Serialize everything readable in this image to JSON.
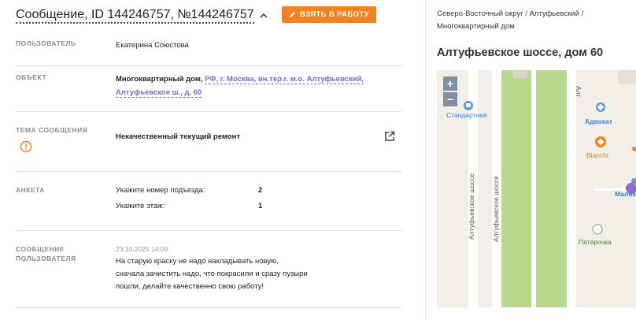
{
  "header": {
    "title": "Сообщение, ID 144246757, №144246757",
    "take_button": "ВЗЯТЬ В РАБОТУ"
  },
  "fields": {
    "user_label": "ПОЛЬЗОВАТЕЛЬ",
    "user_value": "Екатерина Союстова",
    "object_label": "ОБЪЕКТ",
    "object_type": "Многоквартирный дом,",
    "object_address_line1": "РФ, г. Москва, вн.тер.г. м.о. Алтуфьевский,",
    "object_address_line2": "Алтуфьевское ш., д. 60",
    "topic_label_1": "ТЕМА СООБЩЕНИЯ",
    "topic_value": "Некачественный текущий ремонт",
    "survey_label": "АНКЕТА",
    "survey": [
      {
        "question": "Укажите номер подъезда:",
        "answer": "2"
      },
      {
        "question": "Укажите этаж:",
        "answer": "1"
      }
    ],
    "message_label_1": "СООБЩЕНИЕ",
    "message_label_2": "ПОЛЬЗОВАТЕЛЯ",
    "message_date": "23.10.2025 14:09",
    "message_line1": "На старую краску не надо накладывать новую,",
    "message_line2": "сначала зачистить надо, что покрасили и сразу пузыри",
    "message_line3": "пошли, делайте качественно свою работу!"
  },
  "side": {
    "breadcrumb_line1": "Северо-Восточный округ / Алтуфьевский /",
    "breadcrumb_line2": "Многоквартирный дом",
    "address_title": "Алтуфьевское шоссе, дом 60"
  },
  "map": {
    "zoom_in": "+",
    "zoom_out": "−",
    "street_label": "Алтуфьевское шоссе",
    "poi_standard": "Стандартная",
    "poi_advokat": "Адвокат",
    "poi_bianchi": "Bianchi",
    "poi_pyaterochka": "Пятёрочка",
    "poi_malik": "Малик",
    "colors": {
      "road_green": "#b9d98c",
      "accent_orange": "#f5821f",
      "link_purple": "#7d6ad0"
    }
  }
}
